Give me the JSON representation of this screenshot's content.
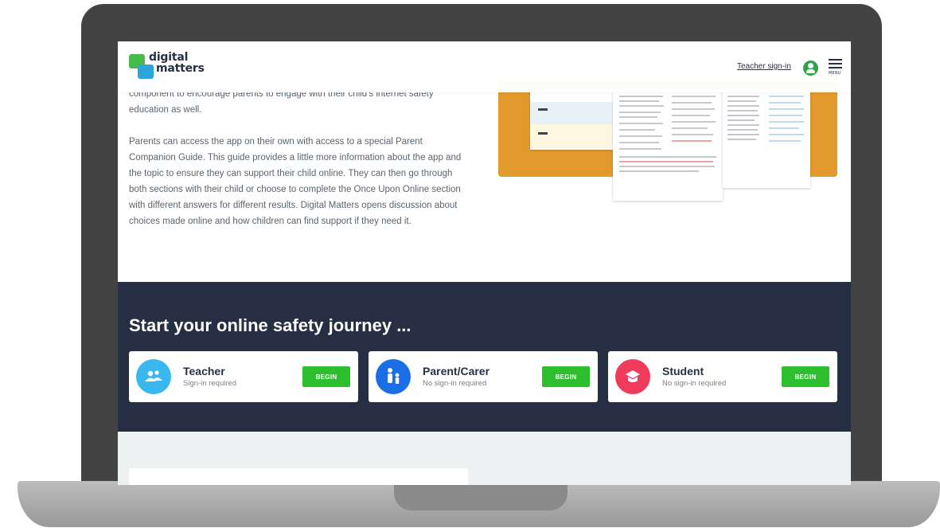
{
  "header": {
    "logo_line1": "digital",
    "logo_line2": "matters",
    "teacher_signin": "Teacher sign-in",
    "menu_label": "MENU"
  },
  "intro": {
    "paragraph1": "component to encourage parents to engage with their child's internet safety education as well.",
    "paragraph2": "Parents can access the app on their own with access to a special Parent Companion Guide. This guide provides a little more information about the app and the topic to ensure they can support their child online. They can then go through both sections with their child or choose to complete the Once Upon Online section with different answers for different results. Digital Matters opens discussion about choices made online and how children can find support if they need it."
  },
  "journey": {
    "title": "Start your online safety journey ...",
    "cards": [
      {
        "name": "Teacher",
        "sub": "Sign-in required",
        "button": "BEGIN",
        "icon": "teacher-icon",
        "color": "#39b8f0"
      },
      {
        "name": "Parent/Carer",
        "sub": "No sign-in required",
        "button": "BEGIN",
        "icon": "parent-child-icon",
        "color": "#1a6ee6"
      },
      {
        "name": "Student",
        "sub": "No sign-in required",
        "button": "BEGIN",
        "icon": "graduation-cap-icon",
        "color": "#f03b5c"
      }
    ]
  },
  "colors": {
    "dark_navy": "#252e42",
    "begin_green": "#2dbf2d",
    "orange": "#e39a2d"
  }
}
